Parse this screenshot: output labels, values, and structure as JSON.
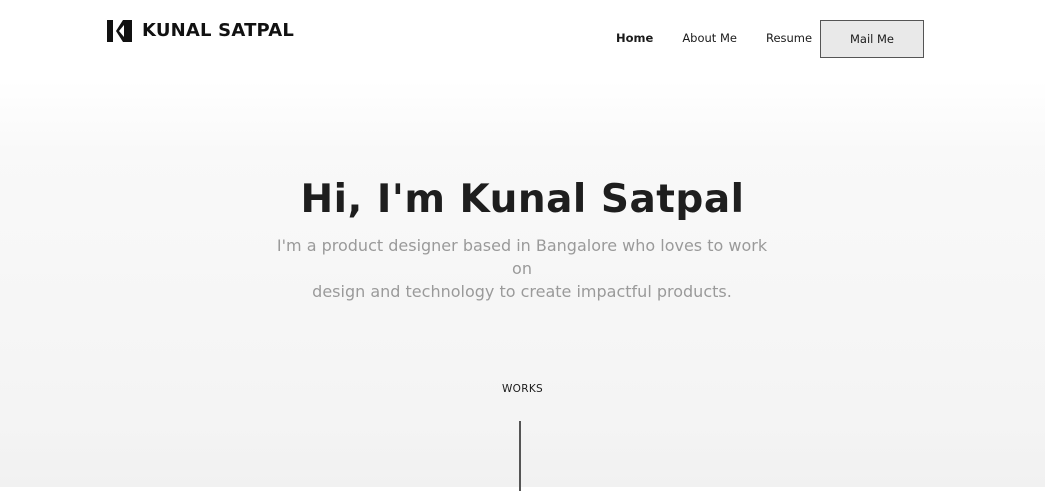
{
  "header": {
    "logo_text": "KUNAL SATPAL",
    "nav": {
      "home": "Home",
      "about": "About Me",
      "resume": "Resume"
    },
    "mail_button": "Mail Me"
  },
  "hero": {
    "title": "Hi, I'm Kunal Satpal",
    "subtitle_line1": "I'm a product designer based in Bangalore who loves to work on",
    "subtitle_line2": "design and technology to create impactful products."
  },
  "works": {
    "label": "WORKS"
  },
  "icons": {
    "logo": "k-monogram-icon",
    "scroll": "scroll-line-indicator"
  },
  "colors": {
    "text_primary": "#1e1e1e",
    "text_muted": "#9a9a9a",
    "button_bg": "#e9e9e9",
    "button_border": "#555555"
  }
}
